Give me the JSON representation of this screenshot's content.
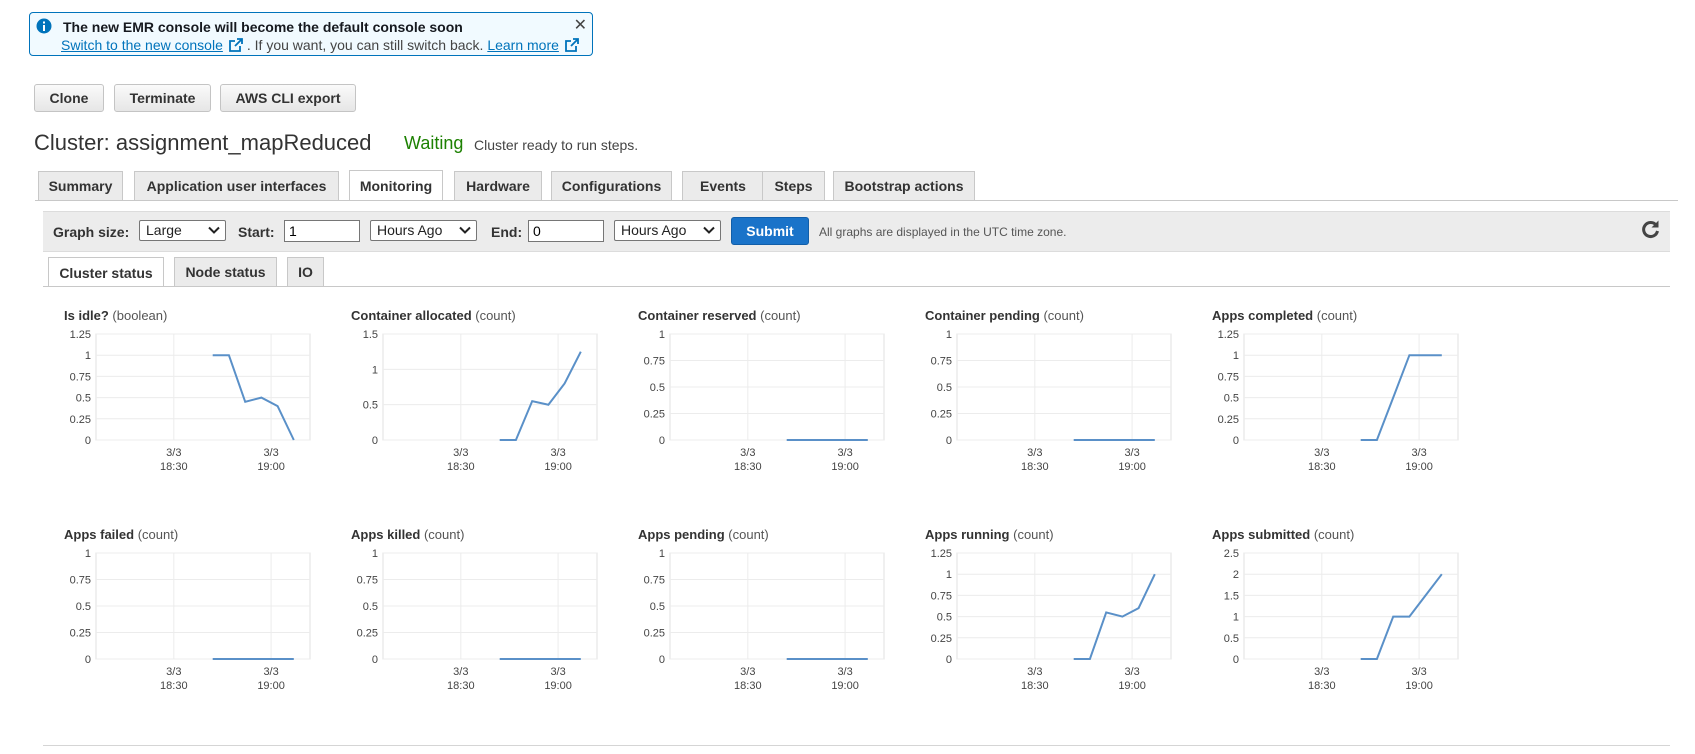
{
  "banner": {
    "title": "The new EMR console will become the default console soon",
    "switch_link": "Switch to the new console",
    "middle_text": ". If you want, you can still switch back.",
    "learn_more": "Learn more",
    "close_glyph": "✕"
  },
  "actions": {
    "clone": "Clone",
    "terminate": "Terminate",
    "cli_export": "AWS CLI export"
  },
  "cluster": {
    "label": "Cluster: assignment_mapReduced",
    "state": "Waiting",
    "state_color": "#1d8102",
    "message": "Cluster ready to run steps."
  },
  "tabs": [
    "Summary",
    "Application user interfaces",
    "Monitoring",
    "Hardware",
    "Configurations",
    "Events",
    "Steps",
    "Bootstrap actions"
  ],
  "active_tab": "Monitoring",
  "toolbar": {
    "graph_size_label": "Graph size:",
    "graph_size_value": "Large",
    "start_label": "Start:",
    "start_value": "1",
    "start_unit": "Hours Ago",
    "end_label": "End:",
    "end_value": "0",
    "end_unit": "Hours Ago",
    "submit_label": "Submit",
    "tz_note": "All graphs are displayed in the UTC time zone."
  },
  "sub_tabs": [
    "Cluster status",
    "Node status",
    "IO"
  ],
  "active_sub_tab": "Cluster status",
  "x_ticks": [
    {
      "date": "3/3",
      "time": "18:30"
    },
    {
      "date": "3/3",
      "time": "19:00"
    }
  ],
  "line_color": "#5a90c8",
  "chart_data": [
    {
      "type": "line",
      "title": "Is idle?",
      "unit": "(boolean)",
      "ylim": [
        0,
        1.25
      ],
      "yticks": [
        "1.25",
        "1",
        "0.75",
        "0.5",
        "0.25",
        "0"
      ],
      "x": [
        "18:42",
        "18:47",
        "18:52",
        "18:57",
        "19:02",
        "19:07"
      ],
      "values": [
        1,
        1,
        0.45,
        0.5,
        0.4,
        0
      ]
    },
    {
      "type": "line",
      "title": "Container allocated",
      "unit": "(count)",
      "ylim": [
        0,
        1.5
      ],
      "yticks": [
        "1.5",
        "1",
        "0.5",
        "0"
      ],
      "x": [
        "18:42",
        "18:47",
        "18:52",
        "18:57",
        "19:02",
        "19:07"
      ],
      "values": [
        0,
        0,
        0.55,
        0.5,
        0.8,
        1.25
      ]
    },
    {
      "type": "line",
      "title": "Container reserved",
      "unit": "(count)",
      "ylim": [
        0,
        1
      ],
      "yticks": [
        "1",
        "0.75",
        "0.5",
        "0.25",
        "0"
      ],
      "x": [
        "18:42",
        "18:47",
        "18:52",
        "18:57",
        "19:02",
        "19:07"
      ],
      "values": [
        0,
        0,
        0,
        0,
        0,
        0
      ]
    },
    {
      "type": "line",
      "title": "Container pending",
      "unit": "(count)",
      "ylim": [
        0,
        1
      ],
      "yticks": [
        "1",
        "0.75",
        "0.5",
        "0.25",
        "0"
      ],
      "x": [
        "18:42",
        "18:47",
        "18:52",
        "18:57",
        "19:02",
        "19:07"
      ],
      "values": [
        0,
        0,
        0,
        0,
        0,
        0
      ]
    },
    {
      "type": "line",
      "title": "Apps completed",
      "unit": "(count)",
      "ylim": [
        0,
        1.25
      ],
      "yticks": [
        "1.25",
        "1",
        "0.75",
        "0.5",
        "0.25",
        "0"
      ],
      "x": [
        "18:42",
        "18:47",
        "18:52",
        "18:57",
        "19:02",
        "19:07"
      ],
      "values": [
        0,
        0,
        0.5,
        1,
        1,
        1
      ]
    },
    {
      "type": "line",
      "title": "Apps failed",
      "unit": "(count)",
      "ylim": [
        0,
        1
      ],
      "yticks": [
        "1",
        "0.75",
        "0.5",
        "0.25",
        "0"
      ],
      "x": [
        "18:42",
        "18:47",
        "18:52",
        "18:57",
        "19:02",
        "19:07"
      ],
      "values": [
        0,
        0,
        0,
        0,
        0,
        0
      ]
    },
    {
      "type": "line",
      "title": "Apps killed",
      "unit": "(count)",
      "ylim": [
        0,
        1
      ],
      "yticks": [
        "1",
        "0.75",
        "0.5",
        "0.25",
        "0"
      ],
      "x": [
        "18:42",
        "18:47",
        "18:52",
        "18:57",
        "19:02",
        "19:07"
      ],
      "values": [
        0,
        0,
        0,
        0,
        0,
        0
      ]
    },
    {
      "type": "line",
      "title": "Apps pending",
      "unit": "(count)",
      "ylim": [
        0,
        1
      ],
      "yticks": [
        "1",
        "0.75",
        "0.5",
        "0.25",
        "0"
      ],
      "x": [
        "18:42",
        "18:47",
        "18:52",
        "18:57",
        "19:02",
        "19:07"
      ],
      "values": [
        0,
        0,
        0,
        0,
        0,
        0
      ]
    },
    {
      "type": "line",
      "title": "Apps running",
      "unit": "(count)",
      "ylim": [
        0,
        1.25
      ],
      "yticks": [
        "1.25",
        "1",
        "0.75",
        "0.5",
        "0.25",
        "0"
      ],
      "x": [
        "18:42",
        "18:47",
        "18:52",
        "18:57",
        "19:02",
        "19:07"
      ],
      "values": [
        0,
        0,
        0.55,
        0.5,
        0.6,
        1
      ]
    },
    {
      "type": "line",
      "title": "Apps submitted",
      "unit": "(count)",
      "ylim": [
        0,
        2.5
      ],
      "yticks": [
        "2.5",
        "2",
        "1.5",
        "1",
        "0.5",
        "0"
      ],
      "x": [
        "18:42",
        "18:47",
        "18:52",
        "18:57",
        "19:02",
        "19:07"
      ],
      "values": [
        0,
        0,
        1,
        1,
        1.5,
        2
      ]
    }
  ]
}
